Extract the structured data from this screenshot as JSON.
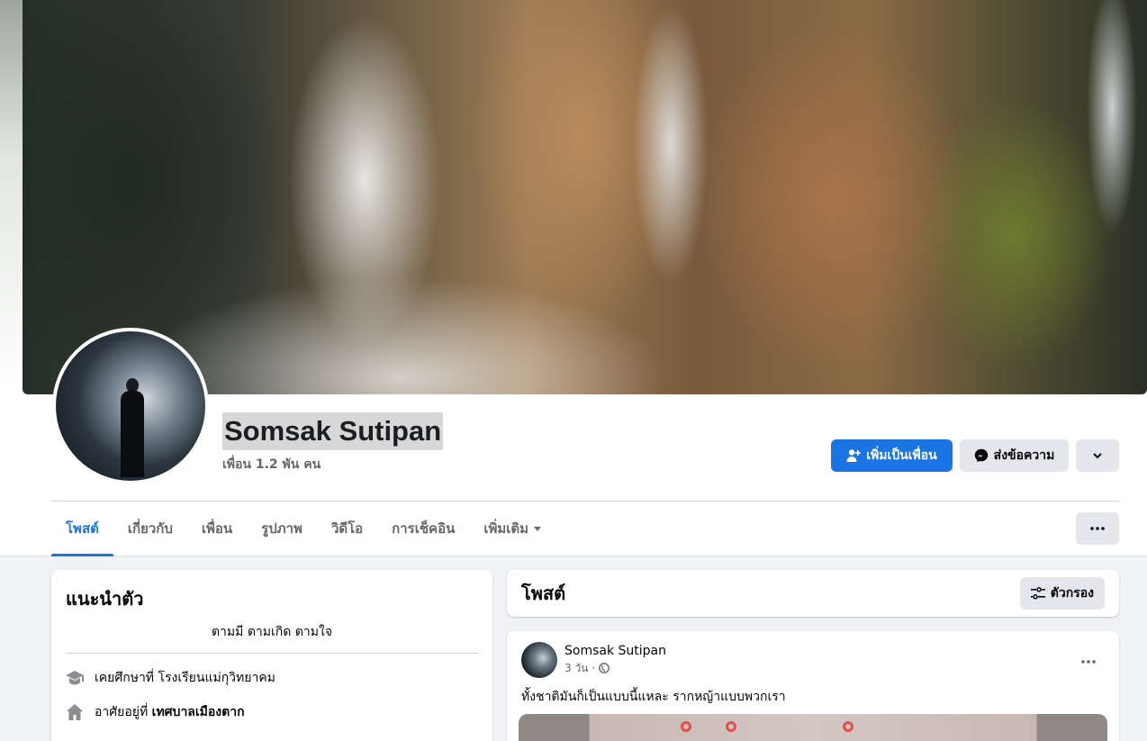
{
  "profile": {
    "name": "Somsak Sutipan",
    "friends_count": "เพื่อน 1.2 พัน คน"
  },
  "actions": {
    "add_friend": "เพิ่มเป็นเพื่อน",
    "message": "ส่งข้อความ"
  },
  "tabs": [
    {
      "label": "โพสต์",
      "active": true
    },
    {
      "label": "เกี่ยวกับ"
    },
    {
      "label": "เพื่อน"
    },
    {
      "label": "รูปภาพ"
    },
    {
      "label": "วิดีโอ"
    },
    {
      "label": "การเช็คอิน"
    },
    {
      "label": "เพิ่มเติม"
    }
  ],
  "intro": {
    "title": "แนะนำตัว",
    "bio": "ตามมี ตามเกิด ตามใจ",
    "education_prefix": "เคยศึกษาที่ โรงเรียนแม่กุวิทยาคม",
    "lives_prefix": "อาศัยอยู่ที่",
    "lives_place": "เทศบาลเมืองตาก"
  },
  "posts": {
    "title": "โพสต์",
    "filter_label": "ตัวกรอง",
    "items": [
      {
        "author": "Somsak Sutipan",
        "time": "3 วัน ·",
        "text": "ทั้งชาติมันก็เป็นแบบนี้แหละ รากหญ้าแบบพวกเรา"
      }
    ]
  },
  "colors": {
    "primary": "#1b74e4",
    "secondary_button": "#e4e6eb",
    "page_background": "#f0f2f5"
  },
  "icons": [
    "add-friend-icon",
    "messenger-icon",
    "chevron-down-icon",
    "more-icon",
    "graduation-cap-icon",
    "home-icon",
    "filter-icon",
    "globe-icon"
  ]
}
